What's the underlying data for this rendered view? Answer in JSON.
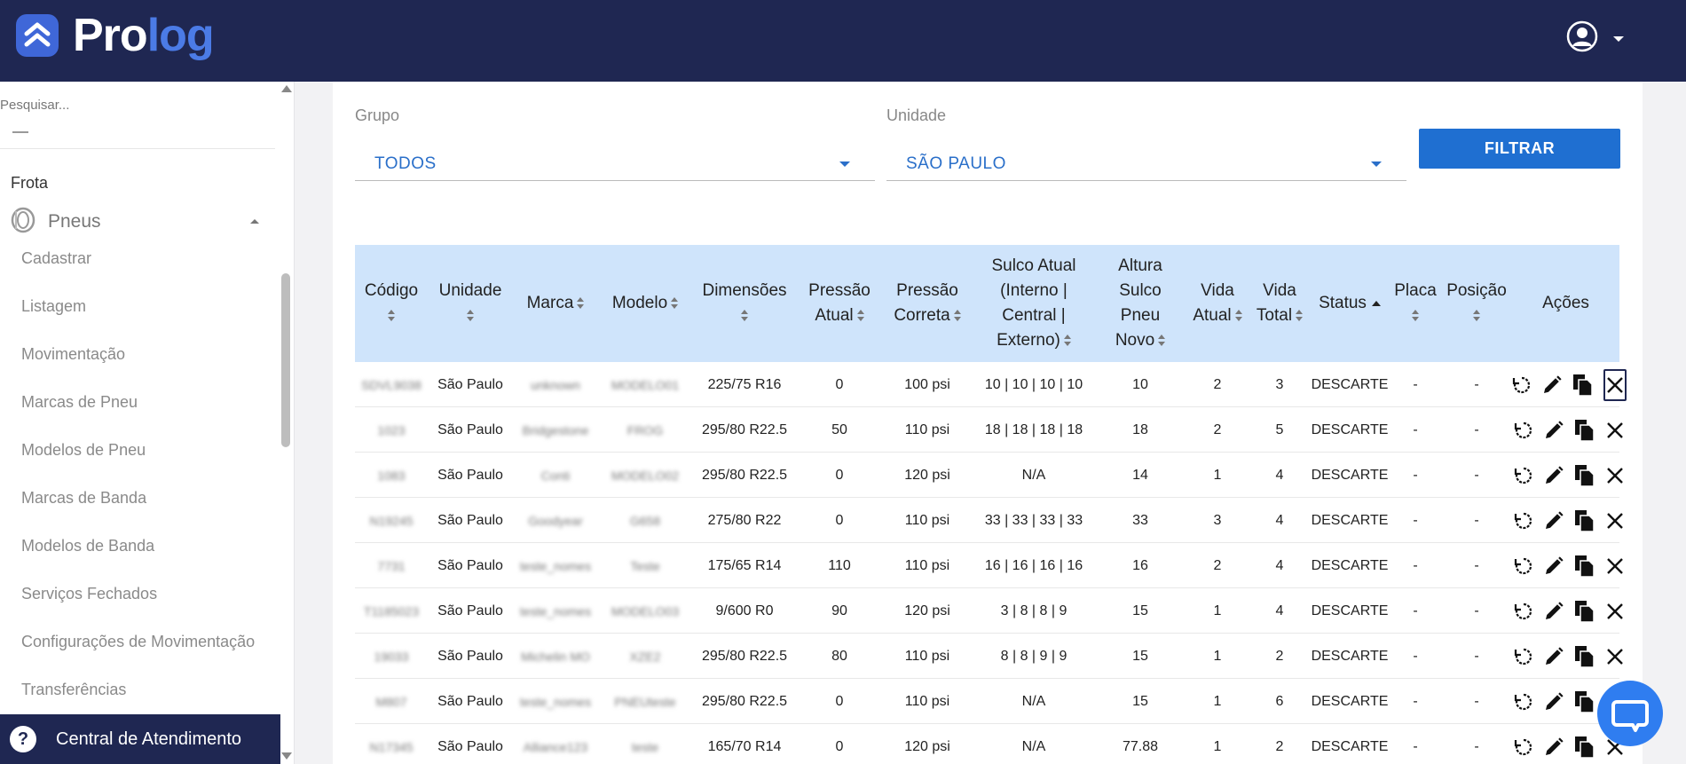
{
  "header": {
    "logo_part1": "Pro",
    "logo_part2": "log",
    "user_icon": "user-circle-icon"
  },
  "sidebar": {
    "search_placeholder": "Pesquisar...",
    "section": "Frota",
    "group": {
      "label": "Pneus",
      "icon": "tire-icon"
    },
    "items": [
      "Cadastrar",
      "Listagem",
      "Movimentação",
      "Marcas de Pneu",
      "Modelos de Pneu",
      "Marcas de Banda",
      "Modelos de Banda",
      "Serviços Fechados",
      "Configurações de Movimentação",
      "Transferências"
    ],
    "help_label": "Central de Atendimento"
  },
  "filters": {
    "grupo": {
      "label": "Grupo",
      "value": "TODOS"
    },
    "unidade": {
      "label": "Unidade",
      "value": "SÃO PAULO"
    },
    "button": "FILTRAR"
  },
  "table": {
    "headers": [
      [
        "Código"
      ],
      [
        "Unidade"
      ],
      [
        "Marca"
      ],
      [
        "Modelo"
      ],
      [
        "Dimensões"
      ],
      [
        "Pressão",
        "Atual"
      ],
      [
        "Pressão",
        "Correta"
      ],
      [
        "Sulco Atual",
        "(Interno |",
        "Central |",
        "Externo)"
      ],
      [
        "Altura",
        "Sulco",
        "Pneu",
        "Novo"
      ],
      [
        "Vida",
        "Atual"
      ],
      [
        "Vida",
        "Total"
      ],
      [
        "Status"
      ],
      [
        "Placa"
      ],
      [
        "Posição"
      ],
      [
        "Ações"
      ]
    ],
    "rows": [
      [
        "SDVL9038",
        "São Paulo",
        "unknown",
        "MODELO01",
        "225/75 R16",
        "0",
        "100 psi",
        "10 | 10 | 10 | 10",
        "10",
        "2",
        "3",
        "DESCARTE",
        "-",
        "-"
      ],
      [
        "1023",
        "São Paulo",
        "Bridgestone",
        "FROG",
        "295/80 R22.5",
        "50",
        "110 psi",
        "18 | 18 | 18 | 18",
        "18",
        "2",
        "5",
        "DESCARTE",
        "-",
        "-"
      ],
      [
        "1083",
        "São Paulo",
        "Conti",
        "MODELO02",
        "295/80 R22.5",
        "0",
        "120 psi",
        "N/A",
        "14",
        "1",
        "4",
        "DESCARTE",
        "-",
        "-"
      ],
      [
        "N19245",
        "São Paulo",
        "Goodyear",
        "G658",
        "275/80 R22",
        "0",
        "110 psi",
        "33 | 33 | 33 | 33",
        "33",
        "3",
        "4",
        "DESCARTE",
        "-",
        "-"
      ],
      [
        "7731",
        "São Paulo",
        "teste_nomes",
        "Teste",
        "175/65 R14",
        "110",
        "110 psi",
        "16 | 16 | 16 | 16",
        "16",
        "2",
        "4",
        "DESCARTE",
        "-",
        "-"
      ],
      [
        "T1185023",
        "São Paulo",
        "teste_nomes",
        "MODELO03",
        "9/600 R0",
        "90",
        "120 psi",
        "3 | 8 | 8 | 9",
        "15",
        "1",
        "4",
        "DESCARTE",
        "-",
        "-"
      ],
      [
        "19033",
        "São Paulo",
        "Michelin MO",
        "XZE2",
        "295/80 R22.5",
        "80",
        "110 psi",
        "8 | 8 | 9 | 9",
        "15",
        "1",
        "2",
        "DESCARTE",
        "-",
        "-"
      ],
      [
        "M807",
        "São Paulo",
        "teste_nomes",
        "PNEUteste",
        "295/80 R22.5",
        "0",
        "110 psi",
        "N/A",
        "15",
        "1",
        "6",
        "DESCARTE",
        "-",
        "-"
      ],
      [
        "N17345",
        "São Paulo",
        "Alliance123",
        "teste",
        "165/70 R14",
        "0",
        "120 psi",
        "N/A",
        "77.88",
        "1",
        "2",
        "DESCARTE",
        "-",
        "-"
      ]
    ]
  },
  "colors": {
    "header_bg": "#1f2752",
    "accent": "#1f6fd1",
    "table_header_bg": "#cfe4fb"
  }
}
